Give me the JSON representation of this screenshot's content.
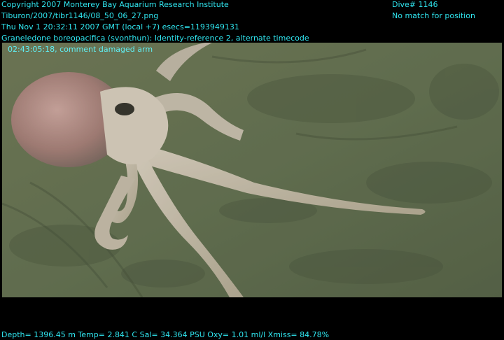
{
  "overlay": {
    "copyright": "Copyright 2007 Monterey Bay Aquarium Research Institute",
    "filename": "Tiburon/2007/tibr1146/08_50_06_27.png",
    "datetime": "Thu Nov  1 20:32:11 2007 GMT (local +7)  esecs=1193949131",
    "species": "Graneledone boreopacifica (svonthun): Identity-reference 2, alternate timecode",
    "comment": "02:43:05:18, comment damaged arm",
    "dive": "Dive# 1146",
    "position": "No match for position",
    "telemetry": "Depth= 1396.45 m  Temp= 2.841 C  Sal= 34.364 PSU  Oxy= 1.01 ml/l  Xmiss= 84.78%"
  },
  "scene": {
    "subject": "octopus on seafloor",
    "colors": {
      "text": "#30e6f0",
      "seafloor": "#5f6a4c",
      "octopus": "#d8c8bc"
    }
  }
}
